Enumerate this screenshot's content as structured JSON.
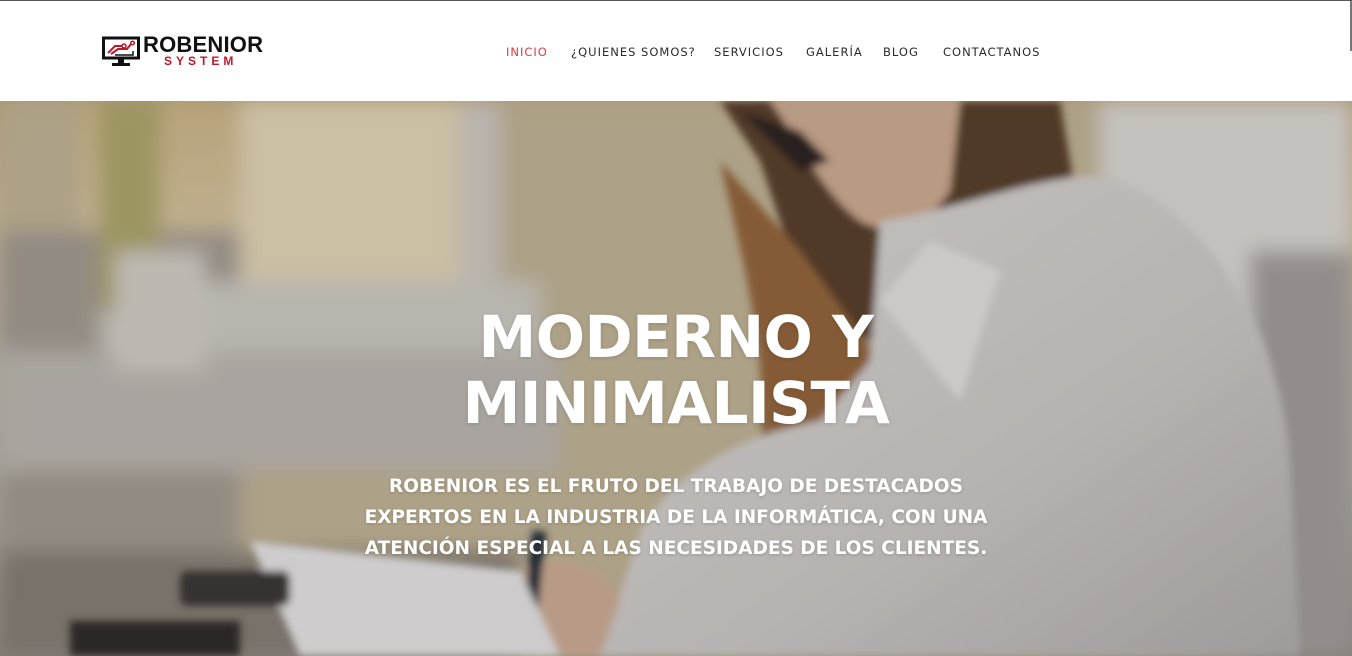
{
  "brand": {
    "name": "ROBENIOR",
    "tagline": "SYSTEM"
  },
  "nav": {
    "items": [
      {
        "label": "INICIO",
        "active": true
      },
      {
        "label": "¿QUIENES SOMOS?",
        "active": false
      },
      {
        "label": "SERVICIOS",
        "active": false
      },
      {
        "label": "GALERÍA",
        "active": false
      },
      {
        "label": "BLOG",
        "active": false
      },
      {
        "label": "CONTACTANOS",
        "active": false
      }
    ]
  },
  "hero": {
    "title": "MODERNO Y MINIMALISTA",
    "subtitle": "ROBENIOR ES EL FRUTO DEL TRABAJO DE DESTACADOS EXPERTOS EN LA INDUSTRIA DE LA INFORMÁTICA, CON UNA ATENCIÓN ESPECIAL A LAS NECESIDADES DE LOS CLIENTES."
  },
  "colors": {
    "accent": "#e0393e",
    "brand_red": "#c0172b",
    "nav_text": "#2b2b2b",
    "hero_text": "#ffffff"
  },
  "icons": {
    "logo": "monitor-circuit-icon"
  }
}
